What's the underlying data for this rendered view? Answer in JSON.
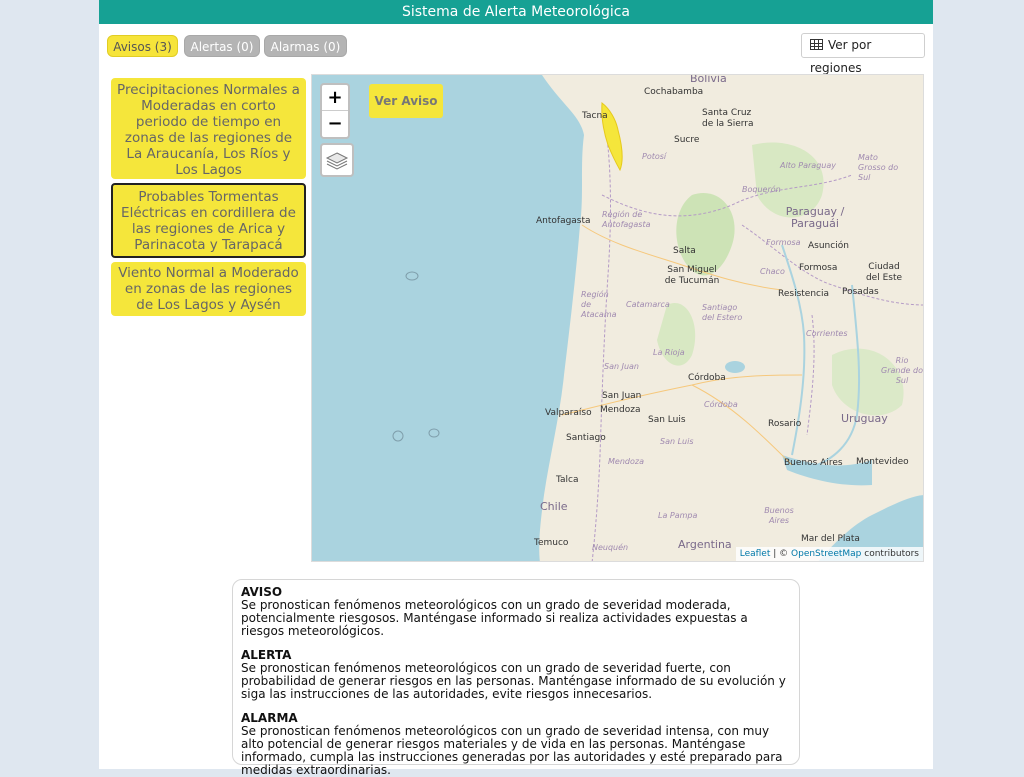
{
  "header": {
    "title": "Sistema de Alerta Meteorológica"
  },
  "tabs": [
    {
      "label": "Avisos (3)",
      "active": true
    },
    {
      "label": "Alertas (0)",
      "active": false
    },
    {
      "label": "Alarmas (0)",
      "active": false
    }
  ],
  "regions_button": {
    "label": "Ver por regiones",
    "icon": "table-grid-icon"
  },
  "alerts": [
    {
      "text": "Precipitaciones Normales a Moderadas en corto periodo de tiempo en zonas de las regiones de La Araucanía, Los Ríos y Los Lagos",
      "selected": false
    },
    {
      "text": "Probables Tormentas Eléctricas en cordillera de las regiones de Arica y Parinacota y Tarapacá",
      "selected": true
    },
    {
      "text": "Viento Normal a Moderado en zonas de las regiones de Los Lagos y Aysén",
      "selected": false
    }
  ],
  "map": {
    "zoom_in": "+",
    "zoom_out": "−",
    "layers_icon": "layers-icon",
    "ver_aviso": "Ver Aviso",
    "attribution_leaflet": "Leaflet",
    "attribution_sep": " | © ",
    "attribution_osm": "OpenStreetMap",
    "attribution_tail": " contributors",
    "labels": {
      "bolivia": "Bolivia",
      "cochabamba": "Cochabamba",
      "santa_cruz": "Santa Cruz de la Sierra",
      "tacna": "Tacna",
      "sucre": "Sucre",
      "potosi": "Potosí",
      "alto_paraguay": "Alto Paraguay",
      "mato_grosso": "Mato Grosso do Sul",
      "boqueron": "Boquerón",
      "antofagasta": "Antofagasta",
      "region_antofagasta": "Región de Antofagasta",
      "paraguay": "Paraguay / Paraguái",
      "salta": "Salta",
      "formosa_region": "Formosa",
      "asuncion": "Asunción",
      "chaco": "Chaco",
      "formosa": "Formosa",
      "ciudad_del_este": "Ciudad del Este",
      "san_miguel": "San Miguel de Tucumán",
      "resistencia": "Resistencia",
      "posadas": "Posadas",
      "region_atacama": "Región de Atacama",
      "catamarca": "Catamarca",
      "santiago_estero": "Santiago del Estero",
      "corrientes": "Corrientes",
      "la_rioja": "La Rioja",
      "rio_grande": "Rio Grande do Sul",
      "san_juan_region": "San Juan",
      "cordoba": "Córdoba",
      "san_juan": "San Juan",
      "mendoza": "Mendoza",
      "valparaiso": "Valparaíso",
      "san_luis": "San Luis",
      "cordoba_region": "Córdoba",
      "uruguay": "Uruguay",
      "santiago": "Santiago",
      "san_luis_region": "San Luis",
      "rosario": "Rosario",
      "mendoza_region": "Mendoza",
      "buenos_aires": "Buenos Aires",
      "montevideo": "Montevideo",
      "talca": "Talca",
      "chile": "Chile",
      "la_pampa": "La Pampa",
      "buenos_aires_region": "Buenos Aires",
      "mar_del_plata": "Mar del Plata",
      "temuco": "Temuco",
      "argentina": "Argentina",
      "neuquen": "Neuquén"
    }
  },
  "legend": {
    "aviso_title": "AVISO",
    "aviso_text": "Se pronostican fenómenos meteorológicos con un grado de severidad moderada, potencialmente riesgosos. Manténgase informado si realiza actividades expuestas a riesgos meteorológicos.",
    "alerta_title": "ALERTA",
    "alerta_text": "Se pronostican fenómenos meteorológicos con un grado de severidad fuerte, con probabilidad de generar riesgos en las personas. Manténgase informado de su evolución y siga las instrucciones de las autoridades, evite riesgos innecesarios.",
    "alarma_title": "ALARMA",
    "alarma_text": "Se pronostican fenómenos meteorológicos con un grado de severidad intensa, con muy alto potencial de generar riesgos materiales y de vida en las personas. Manténgase informado, cumpla las instrucciones generadas por las autoridades y esté preparado para medidas extraordinarias."
  },
  "colors": {
    "header": "#16a194",
    "aviso_yellow": "#f5e63b",
    "tab_inactive": "#b4b4b4",
    "ocean": "#aad3df",
    "land": "#f1ecdf"
  }
}
